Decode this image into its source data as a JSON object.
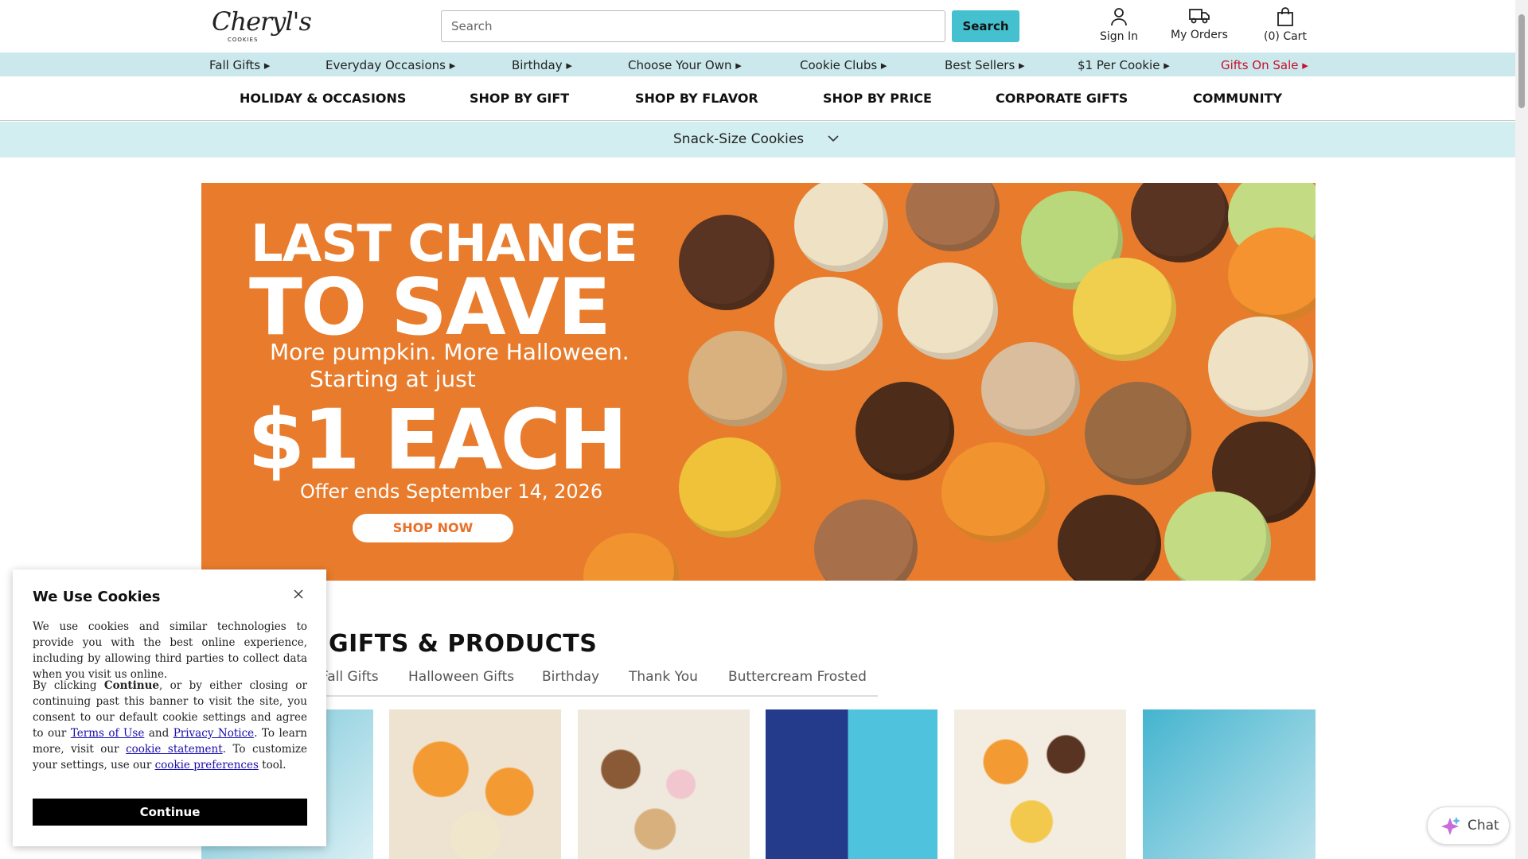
{
  "header": {
    "logo_text": "Cheryl's",
    "logo_sub": "COOKIES",
    "search_placeholder": "Search",
    "search_button": "Search",
    "sign_in": "Sign In",
    "my_orders": "My Orders",
    "cart": "(0) Cart"
  },
  "category_strip": [
    {
      "label": "Fall Gifts ▸"
    },
    {
      "label": "Everyday Occasions ▸"
    },
    {
      "label": "Birthday ▸"
    },
    {
      "label": "Choose Your Own ▸"
    },
    {
      "label": "Cookie Clubs ▸"
    },
    {
      "label": "Best Sellers ▸"
    },
    {
      "label": "$1 Per Cookie ▸"
    },
    {
      "label": "Gifts On Sale ▸"
    }
  ],
  "main_nav": [
    {
      "label": "HOLIDAY & OCCASIONS"
    },
    {
      "label": "SHOP BY GIFT"
    },
    {
      "label": "SHOP BY FLAVOR"
    },
    {
      "label": "SHOP BY PRICE"
    },
    {
      "label": "CORPORATE GIFTS"
    },
    {
      "label": "COMMUNITY"
    }
  ],
  "snack_bar": {
    "label": "Snack-Size Cookies"
  },
  "banner": {
    "line1": "LAST CHANCE",
    "line2": "TO SAVE",
    "line3": "More pumpkin. More Halloween.",
    "line4": "Starting at just",
    "line5": "$1 EACH",
    "line6": "Offer ends September 14, 2026",
    "cta": "SHOP NOW"
  },
  "gifts_products": {
    "title": "GIFTS & PRODUCTS",
    "tabs": [
      {
        "label": "Fall Gifts"
      },
      {
        "label": "Halloween Gifts"
      },
      {
        "label": "Birthday"
      },
      {
        "label": "Thank You"
      },
      {
        "label": "Buttercream Frosted"
      }
    ]
  },
  "cookie_consent": {
    "title": "We Use Cookies",
    "p1": "We use cookies and similar technologies to provide you with the best online experience, including by allowing third parties to collect data when you visit us online.",
    "p2_a": "By clicking ",
    "p2_bold": "Continue",
    "p2_b": ", or by either closing or continuing past this banner to visit the site, you consent to our default cookie settings and agree to our ",
    "terms_link": "Terms of Use",
    "p2_c": " and ",
    "privacy_link": "Privacy Notice",
    "p2_d": ". To learn more, visit our ",
    "statement_link": "cookie statement",
    "p2_e": ". To customize your settings, use our ",
    "preferences_link": "cookie preferences",
    "p2_f": " tool.",
    "button": "Continue"
  },
  "chat": {
    "label": "Chat"
  },
  "colors": {
    "accent": "#44c0cf",
    "strip_bg": "#cbe9ec",
    "banner_bg": "#e87c2c",
    "sale_red": "#c8102e"
  }
}
